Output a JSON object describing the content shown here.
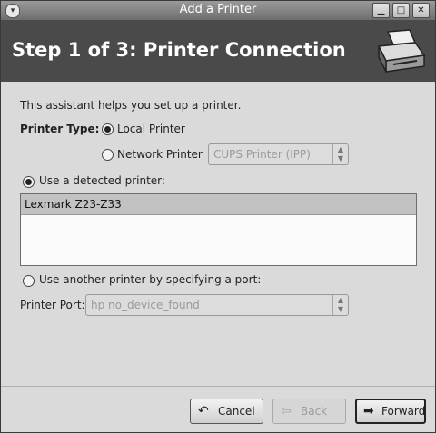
{
  "window": {
    "title": "Add a Printer",
    "controls": {
      "minimize": "▁",
      "maximize": "□",
      "close": "✕"
    }
  },
  "banner": {
    "heading": "Step 1 of 3: Printer Connection"
  },
  "intro": "This assistant helps you set up a printer.",
  "printer_type": {
    "label": "Printer Type:",
    "local": {
      "label": "Local Printer",
      "selected": true
    },
    "network": {
      "label": "Network Printer",
      "selected": false
    },
    "network_combo": "CUPS Printer (IPP)"
  },
  "detected": {
    "label": "Use a detected printer:",
    "selected": true,
    "printers": [
      "Lexmark Z23-Z33"
    ]
  },
  "another": {
    "label": "Use another printer by specifying a port:",
    "selected": false
  },
  "port": {
    "label": "Printer Port:",
    "value": "hp no_device_found"
  },
  "buttons": {
    "cancel": "Cancel",
    "back": "Back",
    "forward": "Forward"
  }
}
